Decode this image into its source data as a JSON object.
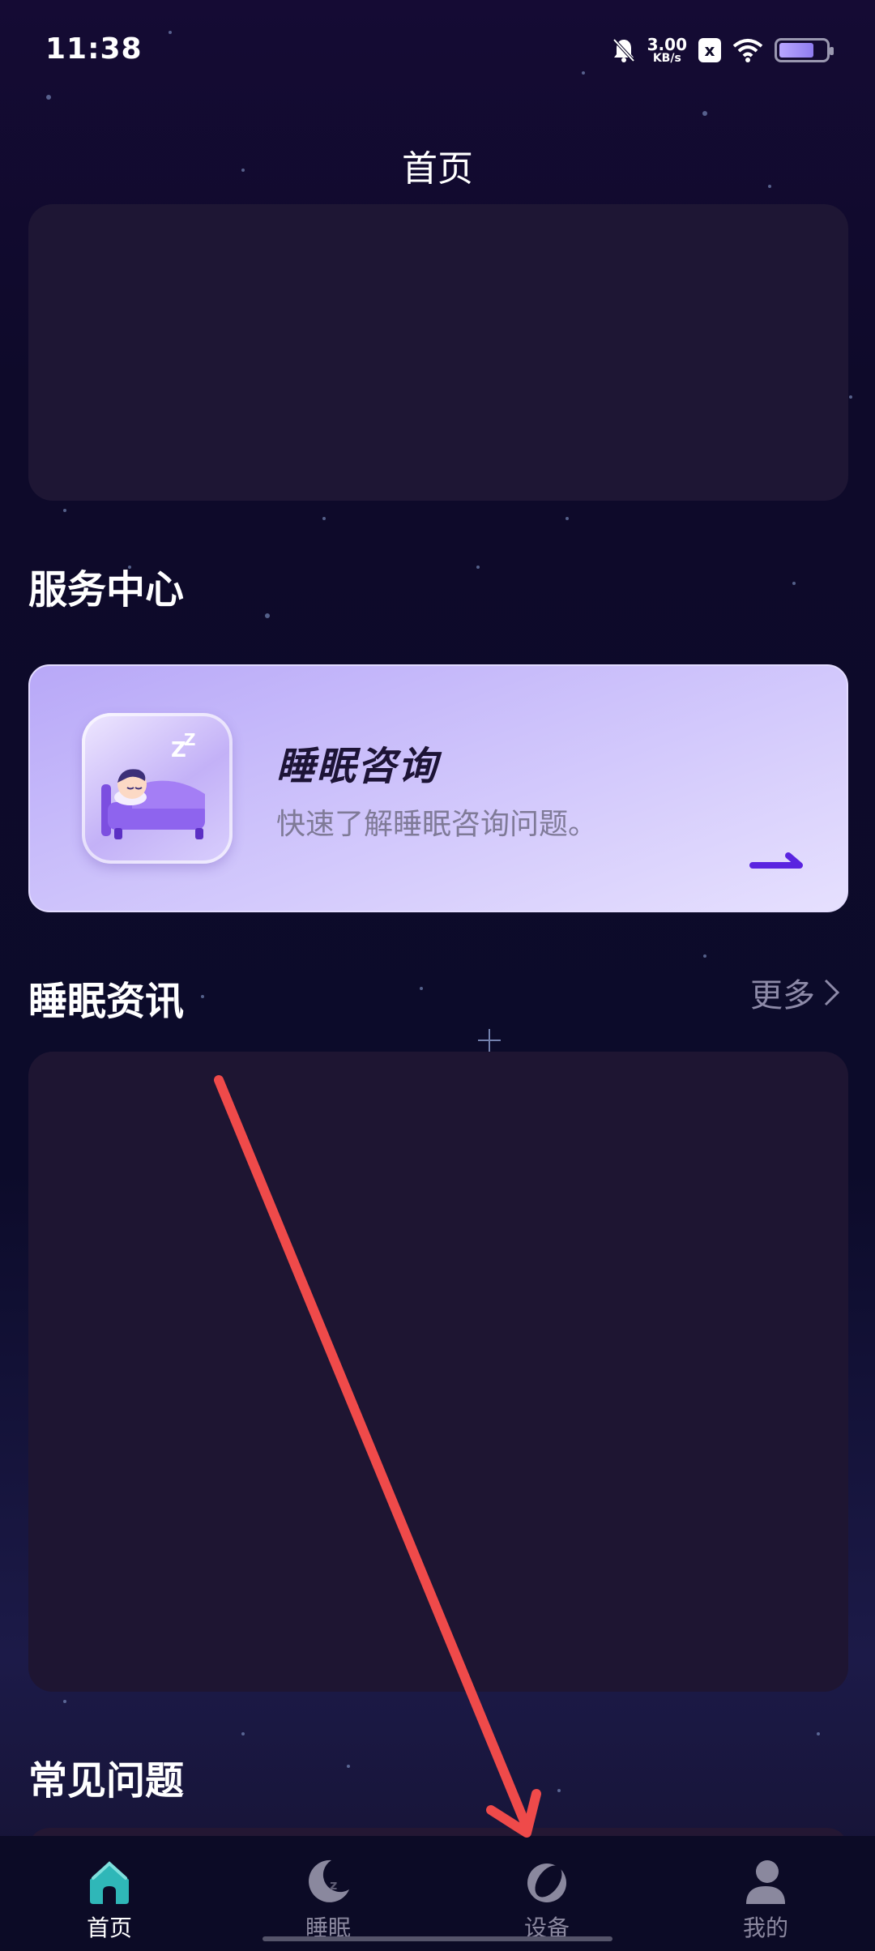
{
  "status_bar": {
    "time": "11:38",
    "net_speed_value": "3.00",
    "net_speed_unit": "KB/s",
    "icons": [
      "bell-muted-icon",
      "close-box-icon",
      "wifi-icon",
      "battery-icon"
    ],
    "x_badge": "x"
  },
  "header": {
    "title": "首页"
  },
  "sections": {
    "service": {
      "title": "服务中心",
      "card": {
        "name": "睡眠咨询",
        "description": "快速了解睡眠咨询问题。",
        "icon": "sleeping-bed-icon",
        "zz": "Z"
      }
    },
    "news": {
      "title": "睡眠资讯",
      "more_label": "更多"
    },
    "faq": {
      "title": "常见问题"
    }
  },
  "tab_bar": {
    "active_index": 0,
    "tabs": [
      {
        "label": "首页",
        "icon": "home-icon"
      },
      {
        "label": "睡眠",
        "icon": "moon-sleep-icon",
        "icon_text": "z"
      },
      {
        "label": "设备",
        "icon": "ring-device-icon"
      },
      {
        "label": "我的",
        "icon": "user-icon"
      }
    ]
  },
  "colors": {
    "background": "#0e0a2a",
    "card_bg": "#1e1634",
    "service_card_start": "#b8a8f8",
    "service_card_end": "#e6e0fe",
    "accent_purple": "#5a24e0",
    "active_tab_teal": "#2fb7b8",
    "annotation_red": "#ef4a4a"
  }
}
